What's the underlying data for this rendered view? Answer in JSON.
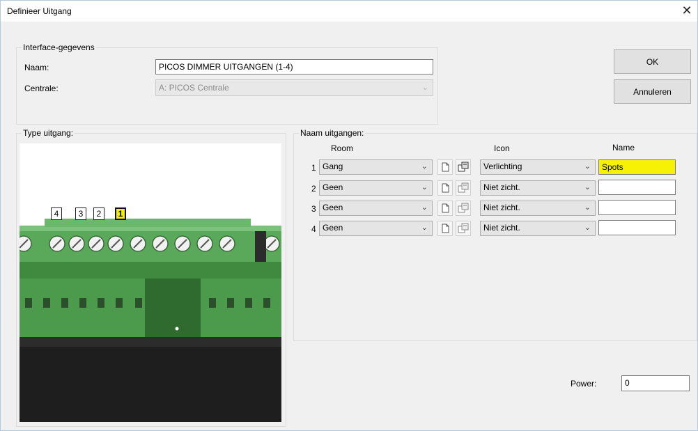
{
  "window": {
    "title": "Definieer Uitgang",
    "close_glyph": "✕"
  },
  "interface": {
    "group_label": "Interface-gegevens",
    "naam_label": "Naam:",
    "naam_value": "PICOS DIMMER UITGANGEN (1-4)",
    "centrale_label": "Centrale:",
    "centrale_value": "A: PICOS Centrale"
  },
  "buttons": {
    "ok": "OK",
    "annuleren": "Annuleren"
  },
  "type_uitgang": {
    "group_label": "Type uitgang:",
    "channel_labels": [
      "4",
      "3",
      "2",
      "1"
    ],
    "active_channel": "1"
  },
  "naam_uitgangen": {
    "group_label": "Naam uitgangen:",
    "columns": {
      "room": "Room",
      "icon": "Icon",
      "name": "Name"
    },
    "rows": [
      {
        "num": "1",
        "room": "Gang",
        "icon": "Verlichting",
        "name": "Spots",
        "highlighted": true
      },
      {
        "num": "2",
        "room": "Geen",
        "icon": "Niet zicht.",
        "name": "",
        "highlighted": false
      },
      {
        "num": "3",
        "room": "Geen",
        "icon": "Niet zicht.",
        "name": "",
        "highlighted": false
      },
      {
        "num": "4",
        "room": "Geen",
        "icon": "Niet zicht.",
        "name": "",
        "highlighted": false
      }
    ]
  },
  "power": {
    "label": "Power:",
    "value": "0"
  },
  "colors": {
    "highlight": "#f7f106",
    "terminal_green": "#4aa04a",
    "dialog_bg": "#f0f0f0"
  },
  "icons": {
    "dropdown": "chevron-down-icon",
    "new": "new-document-icon",
    "properties": "properties-icon"
  }
}
